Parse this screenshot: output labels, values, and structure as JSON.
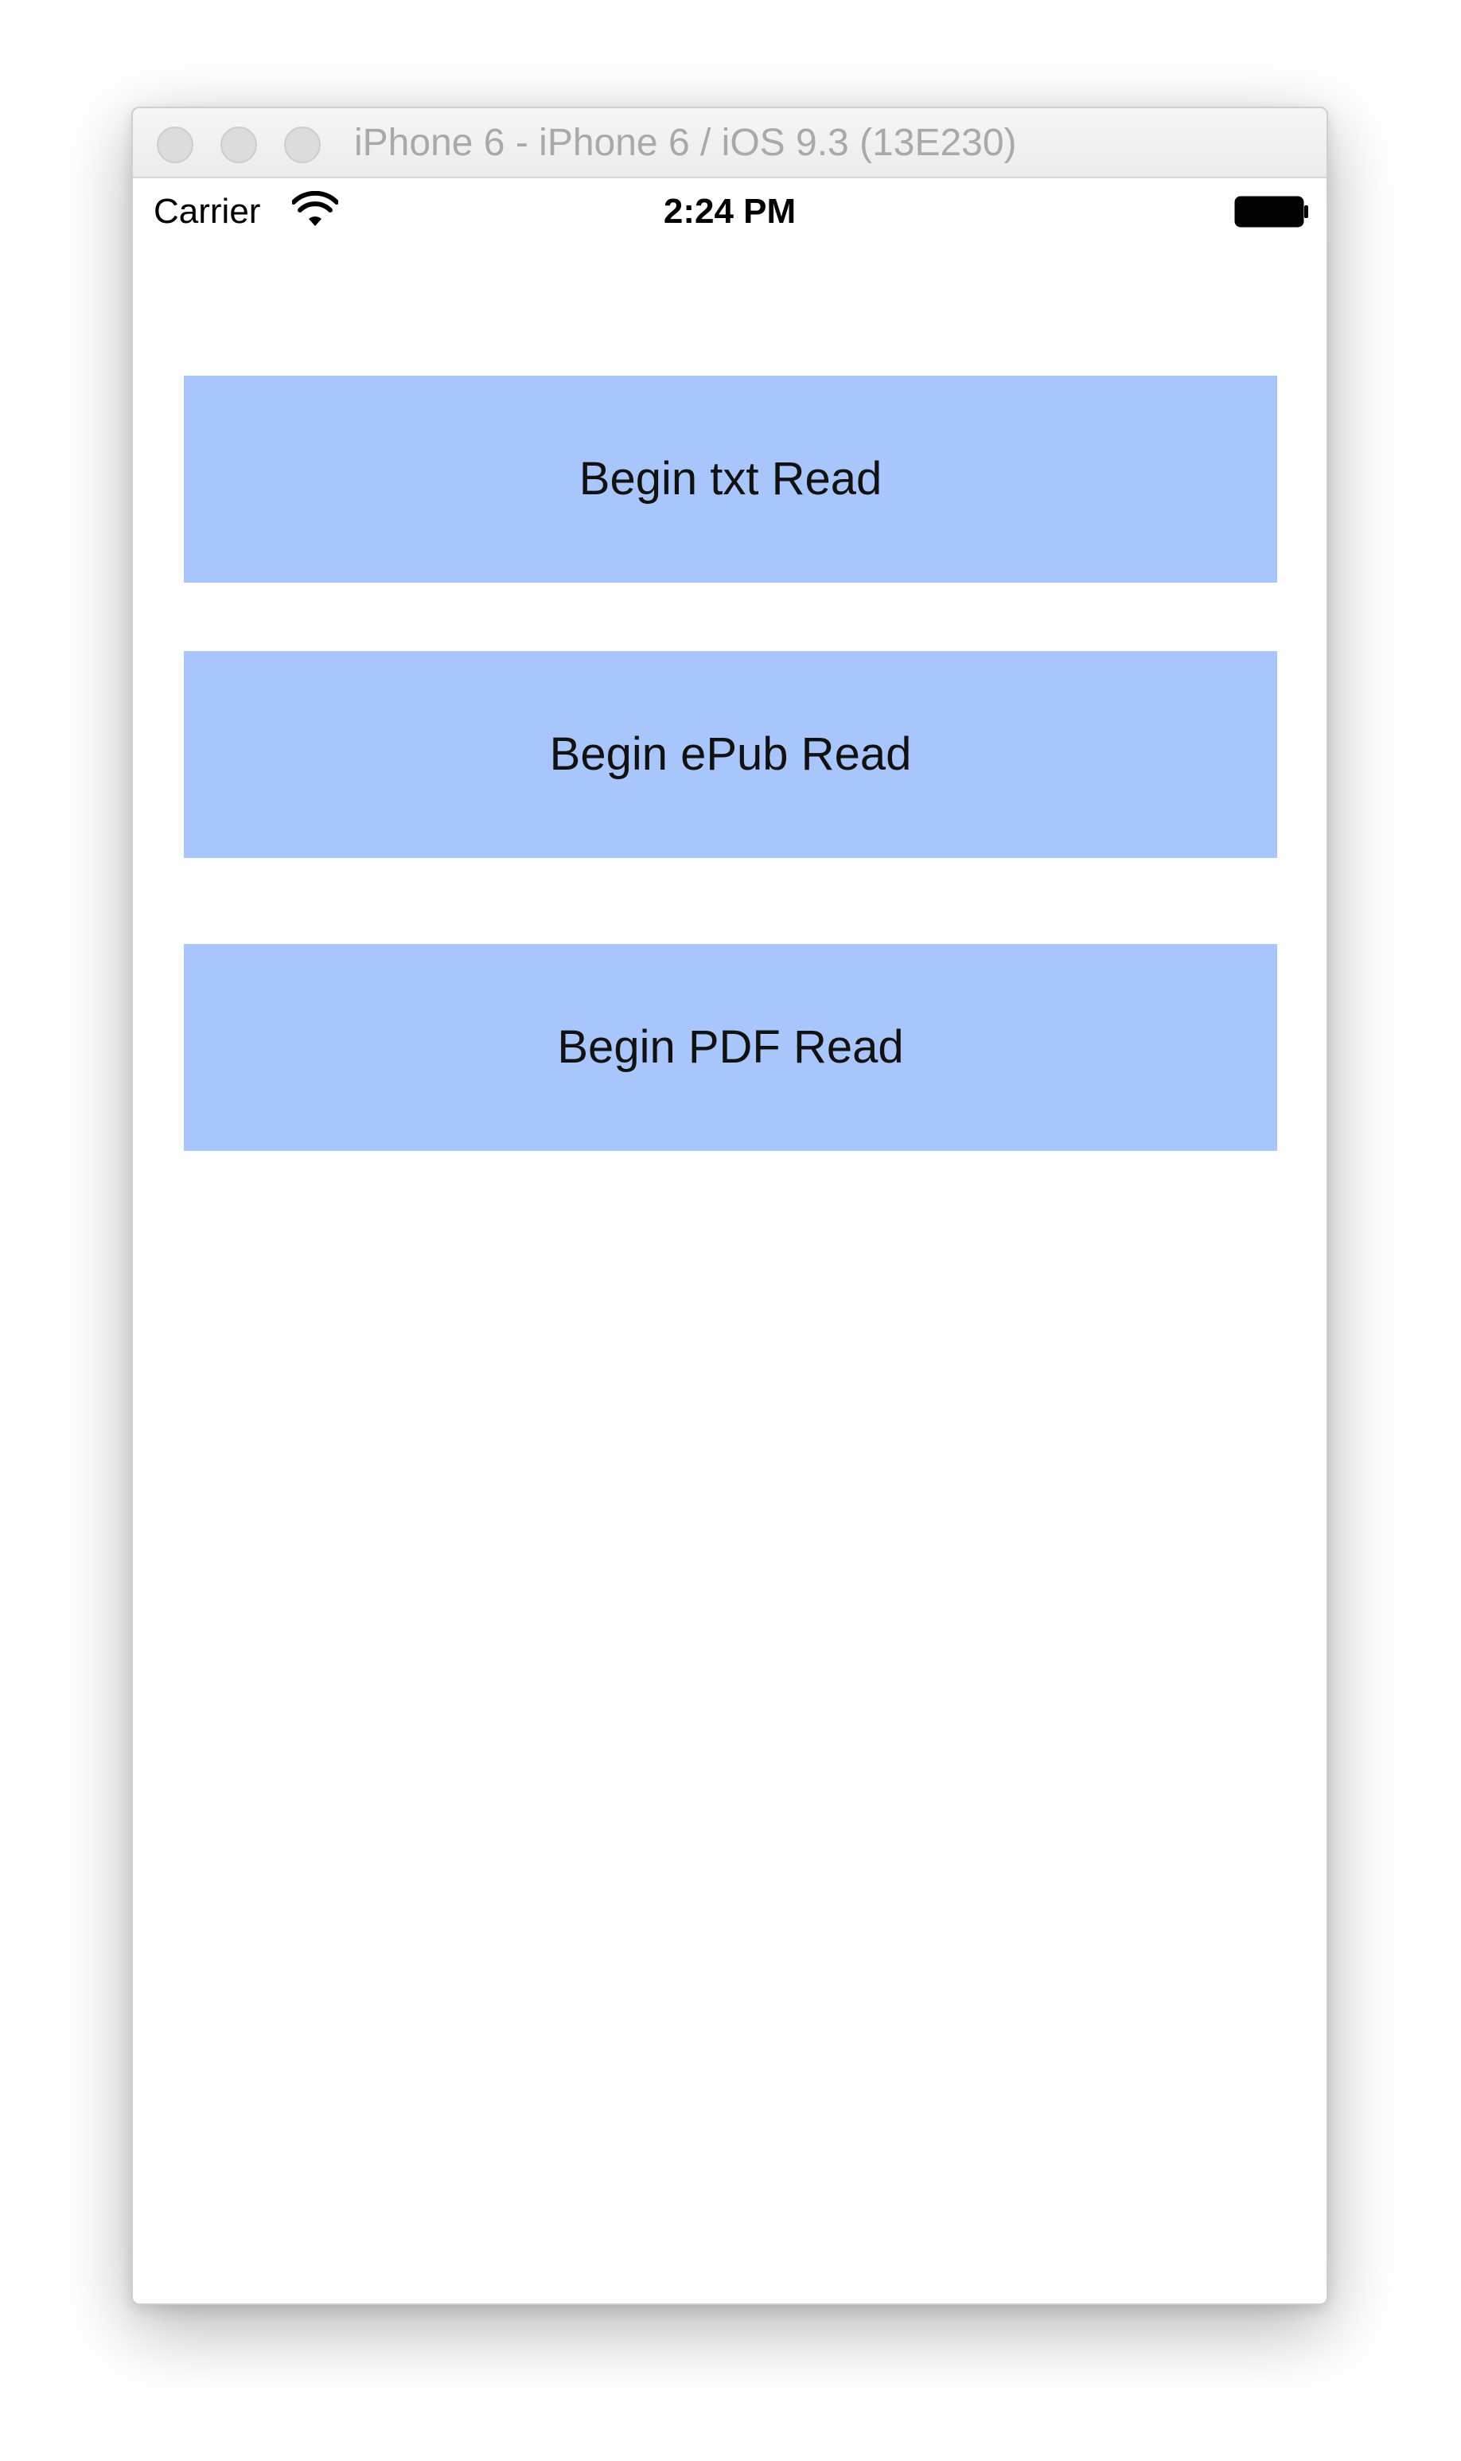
{
  "window": {
    "title": "iPhone 6 - iPhone 6 / iOS 9.3 (13E230)"
  },
  "status_bar": {
    "carrier": "Carrier",
    "time": "2:24 PM",
    "wifi_icon": "wifi-icon",
    "battery_icon": "battery-icon"
  },
  "buttons": {
    "txt_label": "Begin txt Read",
    "epub_label": "Begin ePub Read",
    "pdf_label": "Begin PDF Read"
  },
  "colors": {
    "button_fill": "#a8c5fc",
    "window_title_text": "#a9a9a9"
  }
}
